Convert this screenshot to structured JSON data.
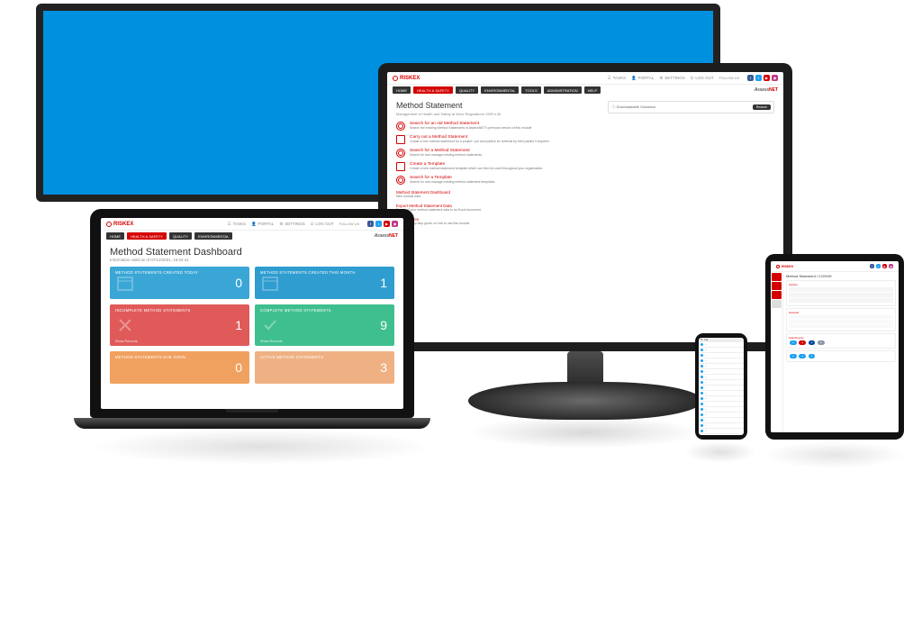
{
  "brand": "RISKEX",
  "assessnet": {
    "pre": "Assess",
    "suf": "NET"
  },
  "topnav": {
    "tasks": "TASKS",
    "portal": "PORTAL",
    "settings": "SETTINGS",
    "logout": "LOG OUT",
    "follow": "FOLLOW US"
  },
  "subnav": {
    "home": "HOME",
    "health": "HEALTH & SAFETY",
    "quality": "QUALITY",
    "environmental": "ENVIRONMENTAL",
    "tools": "TOOLS",
    "admin": "ADMINISTRATION",
    "help": "HELP"
  },
  "monitor": {
    "title": "Method Statement",
    "subtitle": "Management of Health and Safety at Work Regulations 1999 s.3b",
    "items": [
      {
        "t": "Search for an old Method Statement",
        "d": "Search the existing Method Statements in AssessNET's previous version of this module"
      },
      {
        "t": "Carry out a Method Statement",
        "d": "Create a new method statement for a project / job and publish for retrieval by third parties if required"
      },
      {
        "t": "Search for a Method Statement",
        "d": "Search for and manage existing method statements"
      },
      {
        "t": "Create a Template",
        "d": "Create a new method statement template which can then be used throughout your organisation"
      },
      {
        "t": "Search for a Template",
        "d": "Search for and manage existing method statement templates"
      }
    ],
    "links": [
      {
        "t": "Method Statement Dashboard",
        "d": "New module data"
      },
      {
        "t": "Export Method Statement Data",
        "d": "Export all your method statement data to an Excel document"
      },
      {
        "t": "User Guides",
        "d": "View a step by step guide on how to use this module"
      }
    ],
    "download": {
      "label": "Downloadable Guidance",
      "btn": "Restore"
    }
  },
  "laptop": {
    "title": "Method Statement Dashboard",
    "subtitle": "Information valid as of 07/12/2021, 15:04:41",
    "cards": [
      {
        "title": "METHOD STATEMENTS CREATED TODAY",
        "value": "0",
        "cls": "c-blue"
      },
      {
        "title": "METHOD STATEMENTS CREATED THIS MONTH",
        "value": "1",
        "cls": "c-blue2"
      },
      {
        "title": "INCOMPLETE METHOD STATEMENTS",
        "value": "1",
        "foot": "Show Records",
        "cls": "c-red"
      },
      {
        "title": "COMPLETE METHOD STATEMENTS",
        "value": "9",
        "foot": "Show Records",
        "cls": "c-green"
      },
      {
        "title": "METHOD STATEMENTS DUE SOON",
        "value": "0",
        "cls": "c-orange"
      },
      {
        "title": "ACTIVE METHOD STATEMENTS",
        "value": "3",
        "cls": "c-orange2"
      }
    ]
  },
  "tablet": {
    "title": "Method Statement / COSHH"
  }
}
